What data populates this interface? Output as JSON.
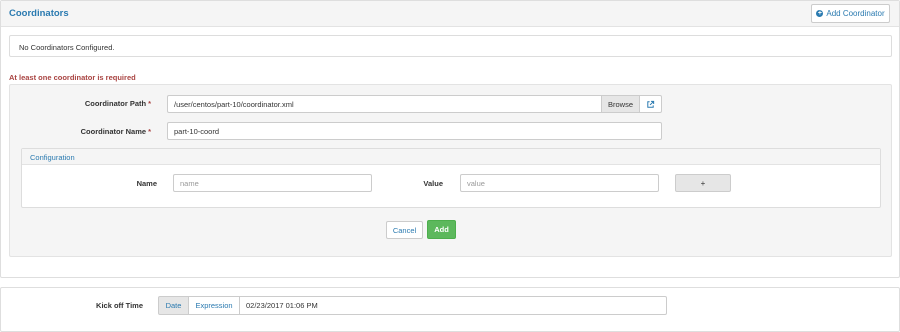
{
  "coordinators": {
    "title": "Coordinators",
    "add_button_label": "Add Coordinator",
    "empty_message": "No Coordinators Configured."
  },
  "validation": {
    "error": "At least one coordinator is required"
  },
  "form": {
    "path_label": "Coordinator Path",
    "path_value": "/user/centos/part-10/coordinator.xml",
    "browse_label": "Browse",
    "name_label": "Coordinator Name",
    "name_value": "part-10-coord",
    "required_marker": "*"
  },
  "configuration": {
    "title": "Configuration",
    "name_label": "Name",
    "name_placeholder": "name",
    "value_label": "Value",
    "value_placeholder": "value",
    "add_label": "+"
  },
  "actions": {
    "cancel_label": "Cancel",
    "add_label": "Add"
  },
  "kickoff": {
    "label": "Kick off Time",
    "mode_date": "Date",
    "mode_expression": "Expression",
    "selected_mode": "Date",
    "value": "02/23/2017 01:06 PM"
  },
  "colors": {
    "link": "#2a7ab0",
    "error": "#a94442",
    "success": "#5cb85c"
  },
  "icons": {
    "add_coordinator": "plus-circle-icon",
    "open_path": "external-link-icon"
  }
}
